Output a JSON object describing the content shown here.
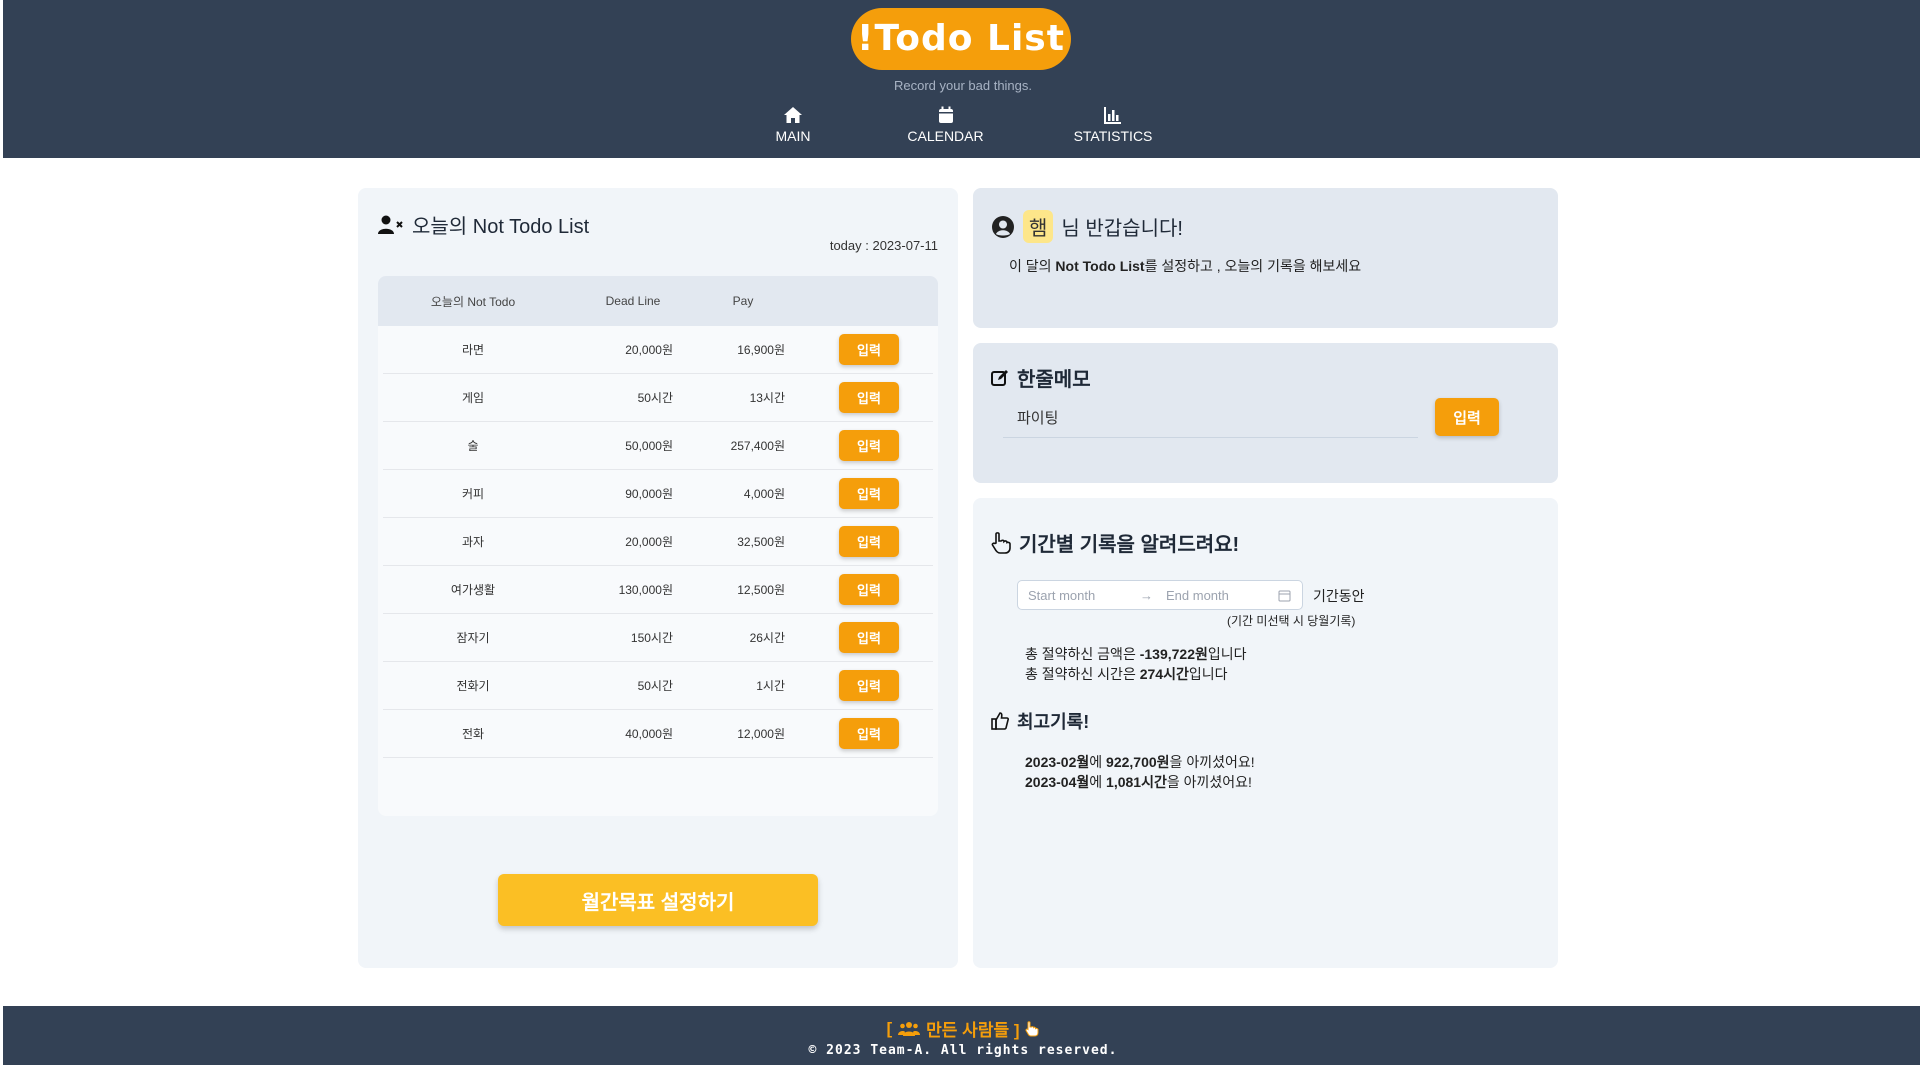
{
  "header": {
    "logo": "!Todo List",
    "tagline": "Record your bad things.",
    "nav": [
      {
        "label": "MAIN",
        "icon": "home-icon"
      },
      {
        "label": "CALENDAR",
        "icon": "calendar-icon"
      },
      {
        "label": "STATISTICS",
        "icon": "chart-icon"
      }
    ]
  },
  "not_todo": {
    "title": "오늘의 Not Todo List",
    "today": "today : 2023-07-11",
    "columns": [
      "오늘의 Not Todo",
      "Dead Line",
      "Pay"
    ],
    "rows": [
      {
        "name": "라면",
        "deadline": "20,000원",
        "pay": "16,900원",
        "button": "입력"
      },
      {
        "name": "게임",
        "deadline": "50시간",
        "pay": "13시간",
        "button": "입력"
      },
      {
        "name": "술",
        "deadline": "50,000원",
        "pay": "257,400원",
        "button": "입력"
      },
      {
        "name": "커피",
        "deadline": "90,000원",
        "pay": "4,000원",
        "button": "입력"
      },
      {
        "name": "과자",
        "deadline": "20,000원",
        "pay": "32,500원",
        "button": "입력"
      },
      {
        "name": "여가생활",
        "deadline": "130,000원",
        "pay": "12,500원",
        "button": "입력"
      },
      {
        "name": "잠자기",
        "deadline": "150시간",
        "pay": "26시간",
        "button": "입력"
      },
      {
        "name": "전화기",
        "deadline": "50시간",
        "pay": "1시간",
        "button": "입력"
      },
      {
        "name": "전화",
        "deadline": "40,000원",
        "pay": "12,000원",
        "button": "입력"
      }
    ],
    "goal_button": "월간목표 설정하기"
  },
  "greeting": {
    "name": "햄",
    "suffix": "님 반갑습니다!",
    "line_prefix": "이 달의 ",
    "line_bold": "Not Todo List",
    "line_suffix": "를 설정하고 , 오늘의 기록을 해보세요"
  },
  "memo": {
    "title": "한줄메모",
    "value": "파이팅",
    "button": "입력"
  },
  "period": {
    "title": "기간별 기록을 알려드려요!",
    "start_placeholder": "Start month",
    "end_placeholder": "End month",
    "range_label": "기간동안",
    "hint": "(기간 미선택 시 당월기록)",
    "money_prefix": "총 절약하신 금액은 ",
    "money_value": "-139,722원",
    "money_suffix": "입니다",
    "time_prefix": "총 절약하신 시간은 ",
    "time_value": "274시간",
    "time_suffix": "입니다",
    "best_title": "최고기록!",
    "best1_month": "2023-02월",
    "best1_mid": "에 ",
    "best1_value": "922,700원",
    "best1_suffix": "을 아끼셨어요!",
    "best2_month": "2023-04월",
    "best2_mid": "에 ",
    "best2_value": "1,081시간",
    "best2_suffix": "을 아끼셨어요!"
  },
  "footer": {
    "open_bracket": "[",
    "makers": "만든 사람들 ]",
    "copyright": "© 2023 Team-A. All rights reserved."
  },
  "colors": {
    "header_bg": "#334155",
    "accent": "#f59e0b",
    "goal_button": "#fbbf24"
  }
}
